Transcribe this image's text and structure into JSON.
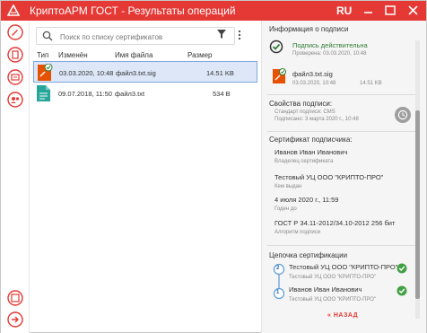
{
  "window": {
    "title": "КриптоАРМ ГОСТ - Результаты операций",
    "lang": "RU",
    "accent": "#e53935"
  },
  "search": {
    "placeholder": "Поиск по списку сертификатов"
  },
  "table": {
    "headers": [
      "Тип",
      "Изменён",
      "Имя файла",
      "Размер"
    ],
    "rows": [
      {
        "icon": "signed-file-icon",
        "modified": "03.03.2020, 10:48",
        "name": "файл3.txt.sig",
        "size": "14.51 KB",
        "selected": true
      },
      {
        "icon": "text-file-icon",
        "modified": "09.07.2018, 11:50",
        "name": "файл3.txt",
        "size": "534 B",
        "selected": false
      }
    ]
  },
  "panel": {
    "heading": "Информация о подписи",
    "status": "Подпись действительна",
    "checked": "Проверена: 03.03.2020, 10:48",
    "file_name": "файл3.txt.sig",
    "file_date": "03.03.2020, 10:48",
    "file_size": "14.51 KB",
    "props_heading": "Свойства подписи:",
    "standard": "Стандарт подписи: CMS",
    "signed": "Подписано: 3 марта 2020 г., 10:48",
    "cert_heading": "Сертификат подписчика:",
    "owner": "Иванов Иван Иванович",
    "owner_label": "Владелец сертификата",
    "issuer": "Тестовый УЦ ООО \"КРИПТО-ПРО\"",
    "issuer_label": "Кем выдан",
    "valid_to": "4 июля 2020 г., 11:59",
    "valid_to_label": "Годен до",
    "algorithm": "ГОСТ Р 34.11-2012/34.10-2012 256 бит",
    "algorithm_label": "Алгоритм подписи",
    "chain_heading": "Цепочка сертификации",
    "chain": [
      {
        "num": "2",
        "name": "Тестовый УЦ ООО \"КРИПТО-ПРО\"",
        "issuer": "Тестовый УЦ ООО \"КРИПТО-ПРО\""
      },
      {
        "num": "1",
        "name": "Иванов Иван Иванович",
        "issuer": "Тестовый УЦ ООО \"КРИПТО-ПРО\""
      }
    ],
    "back": "« НАЗАД"
  }
}
